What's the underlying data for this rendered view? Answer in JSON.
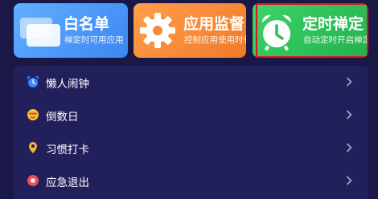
{
  "cards": [
    {
      "title": "白名单",
      "subtitle": "禅定时可用应用",
      "icon": "whitelist-cards-icon"
    },
    {
      "title": "应用监督",
      "subtitle": "控制应用使用时长",
      "icon": "gear-icon"
    },
    {
      "title": "定时禅定",
      "subtitle": "自动定时开启禅定",
      "icon": "alarm-clock-icon"
    }
  ],
  "menu": [
    {
      "label": "懒人闹钟",
      "icon": "alarm-clock-icon"
    },
    {
      "label": "倒数日",
      "icon": "smiley-face-icon"
    },
    {
      "label": "习惯打卡",
      "icon": "location-pin-icon"
    },
    {
      "label": "应急退出",
      "icon": "stop-icon"
    }
  ],
  "colors": {
    "background": "#1a1847",
    "list_background": "#21205a",
    "whitelist_card": "#4a98f8",
    "monitor_card": "#f78a36",
    "timed_card": "#2ec15a",
    "selection_border": "#e3141d"
  }
}
